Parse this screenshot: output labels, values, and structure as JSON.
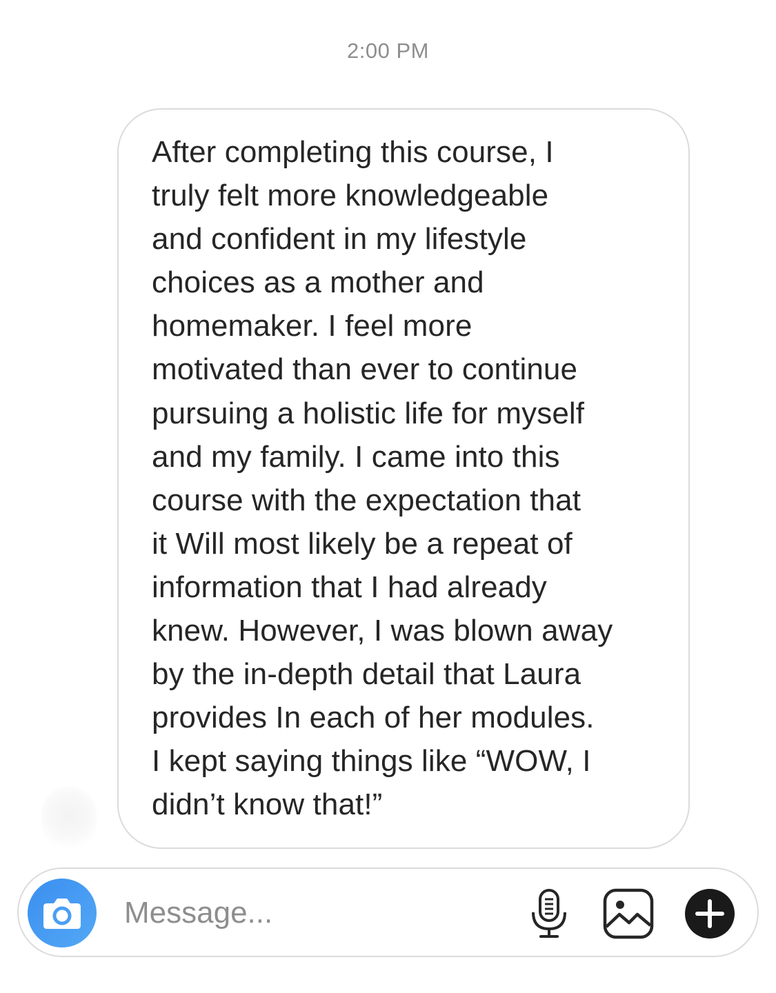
{
  "thread": {
    "timestamp": "2:00 PM"
  },
  "message": {
    "text": "After completing this course, I\ntruly felt more knowledgeable\nand confident in my lifestyle\nchoices as a mother and\nhomemaker. I feel more\nmotivated than ever to continue\npursuing a holistic life for myself\nand my family. I came into this\ncourse with the expectation that\nit Will most likely be a repeat of\ninformation that I had already\nknew. However, I was blown away\nby the in-depth detail that Laura\nprovides In each of her modules.\nI kept saying things like “WOW, I\ndidn’t know that!”"
  },
  "composer": {
    "placeholder": "Message...",
    "value": "",
    "icons": {
      "camera": "camera-icon",
      "mic": "microphone-icon",
      "gallery": "image-gallery-icon",
      "plus": "plus-icon"
    },
    "colors": {
      "camera_button": "#3b8ff0",
      "plus_button": "#1a1a1a"
    }
  }
}
